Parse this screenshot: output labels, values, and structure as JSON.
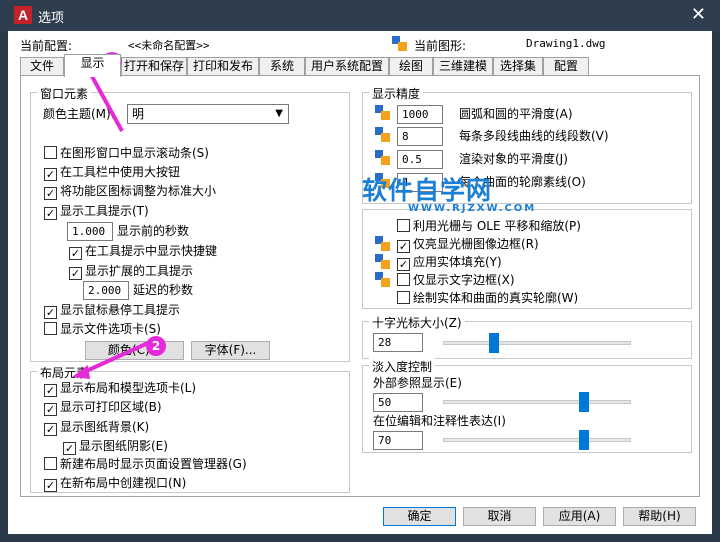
{
  "window": {
    "title": "选项"
  },
  "header": {
    "current_config_label": "当前配置:",
    "current_config_value": "<<未命名配置>>",
    "current_drawing_label": "当前图形:",
    "current_drawing_value": "Drawing1.dwg"
  },
  "tabs": [
    "文件",
    "显示",
    "打开和保存",
    "打印和发布",
    "系统",
    "用户系统配置",
    "绘图",
    "三维建模",
    "选择集",
    "配置"
  ],
  "window_elements": {
    "title": "窗口元素",
    "color_theme_label": "颜色主题(M):",
    "color_theme_value": "明",
    "items": [
      {
        "label": "在图形窗口中显示滚动条(S)",
        "checked": false
      },
      {
        "label": "在工具栏中使用大按钮",
        "checked": true
      },
      {
        "label": "将功能区图标调整为标准大小",
        "checked": true
      },
      {
        "label": "显示工具提示(T)",
        "checked": true
      }
    ],
    "delay_value": "1.000",
    "delay_label": "显示前的秒数",
    "shortcut_label": "在工具提示中显示快捷键",
    "extended_label": "显示扩展的工具提示",
    "extended_delay_value": "2.000",
    "extended_delay_label": "延迟的秒数",
    "rollover_label": "显示鼠标悬停工具提示",
    "file_tabs_label": "显示文件选项卡(S)",
    "colors_button": "颜色(C)...",
    "fonts_button": "字体(F)..."
  },
  "layout_elements": {
    "title": "布局元素",
    "items": [
      {
        "label": "显示布局和模型选项卡(L)",
        "checked": true
      },
      {
        "label": "显示可打印区域(B)",
        "checked": true
      },
      {
        "label": "显示图纸背景(K)",
        "checked": true
      },
      {
        "label": "显示图纸阴影(E)",
        "checked": true
      },
      {
        "label": "新建布局时显示页面设置管理器(G)",
        "checked": false
      },
      {
        "label": "在新布局中创建视口(N)",
        "checked": true
      }
    ]
  },
  "display_resolution": {
    "title": "显示精度",
    "items": [
      {
        "value": "1000",
        "label": "圆弧和圆的平滑度(A)"
      },
      {
        "value": "8",
        "label": "每条多段线曲线的线段数(V)"
      },
      {
        "value": "0.5",
        "label": "渲染对象的平滑度(J)"
      },
      {
        "value": "4",
        "label": "每个曲面的轮廓素线(O)"
      }
    ]
  },
  "display_performance": {
    "items": [
      {
        "label": "利用光栅与 OLE 平移和缩放(P)",
        "checked": false
      },
      {
        "label": "仅亮显光栅图像边框(R)",
        "checked": true
      },
      {
        "label": "应用实体填充(Y)",
        "checked": true
      },
      {
        "label": "仅显示文字边框(X)",
        "checked": false
      },
      {
        "label": "绘制实体和曲面的真实轮廓(W)",
        "checked": false
      }
    ]
  },
  "crosshair": {
    "title": "十字光标大小(Z)",
    "value": "28",
    "level_percent": 28
  },
  "fade": {
    "title": "淡入度控制",
    "xref_label": "外部参照显示(E)",
    "xref_value": "50",
    "xref_level_percent": 80,
    "inplace_label": "在位编辑和注释性表达(I)",
    "inplace_value": "70",
    "inplace_level_percent": 80
  },
  "watermark": {
    "main": "软件自学网",
    "sub": "WWW.RJZXW.COM"
  },
  "annotations": {
    "badge1": "1",
    "badge2": "2"
  },
  "footer": {
    "ok": "确定",
    "cancel": "取消",
    "apply": "应用(A)",
    "help": "帮助(H)"
  },
  "colors": {
    "accent": "#0078d7",
    "badge": "#e52bd8",
    "titlebar": "#2e3e4e",
    "watermark": "#1b7fd6"
  }
}
